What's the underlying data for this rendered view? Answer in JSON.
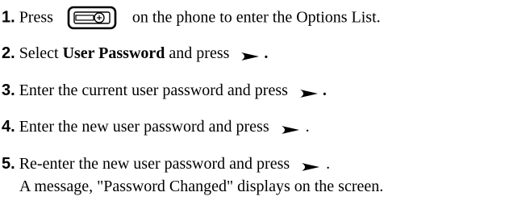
{
  "steps": [
    {
      "number": "1.",
      "text_before_icon": "Press",
      "icon": "options-key-icon",
      "text_after_icon": "on the phone to enter the Options List."
    },
    {
      "number": "2.",
      "text_before_bold": "Select",
      "bold_text": "User Password",
      "text_after_bold": "and press",
      "icon": "right-arrow-key-icon",
      "trailing": "."
    },
    {
      "number": "3.",
      "text": "Enter the current user password and press",
      "icon": "right-arrow-key-icon",
      "trailing": "."
    },
    {
      "number": "4.",
      "text": "Enter the new user password and press",
      "icon": "right-arrow-key-icon",
      "trailing": "."
    },
    {
      "number": "5.",
      "text": "Re-enter the new user password and press",
      "icon": "right-arrow-key-icon",
      "trailing": ".",
      "note": "A message, \"Password Changed\" displays on the screen."
    }
  ]
}
